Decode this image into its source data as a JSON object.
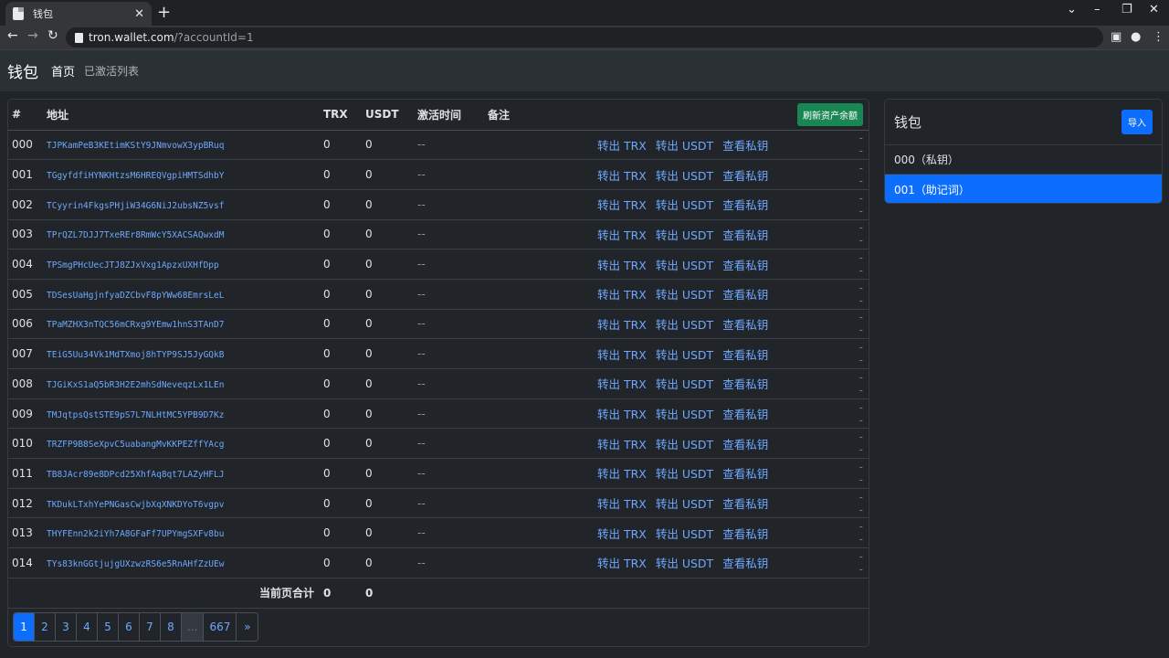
{
  "browser": {
    "tab_title": "钱包",
    "tab_close": "✕",
    "new_tab": "+",
    "url_host": "tron.wallet.com",
    "url_path": "/?accountId=1"
  },
  "nav": {
    "brand": "钱包",
    "home": "首页",
    "activated_list": "已激活列表"
  },
  "table": {
    "headers": {
      "index": "#",
      "address": "地址",
      "trx": "TRX",
      "usdt": "USDT",
      "activated_at": "激活时间",
      "note": "备注"
    },
    "refresh_label": "刷新资产余额",
    "action_labels": {
      "send_trx": "转出 TRX",
      "send_usdt": "转出 USDT",
      "view_key": "查看私钥"
    },
    "rows": [
      {
        "idx": "000",
        "address": "TJPKamPeB3KEtimKStY9JNmvowX3ypBRuq",
        "trx": "0",
        "usdt": "0",
        "time": "--",
        "tail": "--"
      },
      {
        "idx": "001",
        "address": "TGgyfdfiHYNKHtzsM6HREQVgpiHMTSdhbY",
        "trx": "0",
        "usdt": "0",
        "time": "--",
        "tail": "--"
      },
      {
        "idx": "002",
        "address": "TCyyrin4FkgsPHjiW34G6NiJ2ubsNZ5vsf",
        "trx": "0",
        "usdt": "0",
        "time": "--",
        "tail": "--"
      },
      {
        "idx": "003",
        "address": "TPrQZL7DJJ7TxeREr8RmWcY5XACSAQwxdM",
        "trx": "0",
        "usdt": "0",
        "time": "--",
        "tail": "--"
      },
      {
        "idx": "004",
        "address": "TPSmgPHcUecJTJ8ZJxVxg1ApzxUXHfDpp",
        "trx": "0",
        "usdt": "0",
        "time": "--",
        "tail": "--"
      },
      {
        "idx": "005",
        "address": "TDSesUaHgjnfyaDZCbvF8pYWw68EmrsLeL",
        "trx": "0",
        "usdt": "0",
        "time": "--",
        "tail": "--"
      },
      {
        "idx": "006",
        "address": "TPaMZHX3nTQC56mCRxg9YEmw1hnS3TAnD7",
        "trx": "0",
        "usdt": "0",
        "time": "--",
        "tail": "--"
      },
      {
        "idx": "007",
        "address": "TEiG5Uu34Vk1MdTXmoj8hTYP9SJ5JyGQkB",
        "trx": "0",
        "usdt": "0",
        "time": "--",
        "tail": "--"
      },
      {
        "idx": "008",
        "address": "TJGiKxS1aQ5bR3H2E2mhSdNeveqzLx1LEn",
        "trx": "0",
        "usdt": "0",
        "time": "--",
        "tail": "--"
      },
      {
        "idx": "009",
        "address": "TMJqtpsQstSTE9pS7L7NLHtMC5YPB9D7Kz",
        "trx": "0",
        "usdt": "0",
        "time": "--",
        "tail": "--"
      },
      {
        "idx": "010",
        "address": "TRZFP9B8SeXpvC5uabangMvKKPEZffYAcg",
        "trx": "0",
        "usdt": "0",
        "time": "--",
        "tail": "--"
      },
      {
        "idx": "011",
        "address": "TB8JAcr89e8DPcd25XhfAq8qt7LAZyHFLJ",
        "trx": "0",
        "usdt": "0",
        "time": "--",
        "tail": "--"
      },
      {
        "idx": "012",
        "address": "TKDukLTxhYePNGasCwjbXqXNKDYoT6vgpv",
        "trx": "0",
        "usdt": "0",
        "time": "--",
        "tail": "--"
      },
      {
        "idx": "013",
        "address": "THYFEnn2k2iYh7A8GFaFf7UPYmgSXFv8bu",
        "trx": "0",
        "usdt": "0",
        "time": "--",
        "tail": "--"
      },
      {
        "idx": "014",
        "address": "TYs83knGGtjujgUXzwzRS6e5RnAHfZzUEw",
        "trx": "0",
        "usdt": "0",
        "time": "--",
        "tail": "--"
      }
    ],
    "summary": {
      "label": "当前页合计",
      "trx": "0",
      "usdt": "0"
    }
  },
  "pagination": {
    "pages": [
      "1",
      "2",
      "3",
      "4",
      "5",
      "6",
      "7",
      "8",
      "...",
      "667",
      "»"
    ],
    "active": "1"
  },
  "wallet": {
    "title": "钱包",
    "import_label": "导入",
    "items": [
      {
        "label": "000（私钥）",
        "active": false
      },
      {
        "label": "001（助记词）",
        "active": true
      }
    ]
  },
  "colors": {
    "accent": "#0d6efd",
    "success": "#198754",
    "link": "#6ea8fe",
    "background": "#212529"
  }
}
